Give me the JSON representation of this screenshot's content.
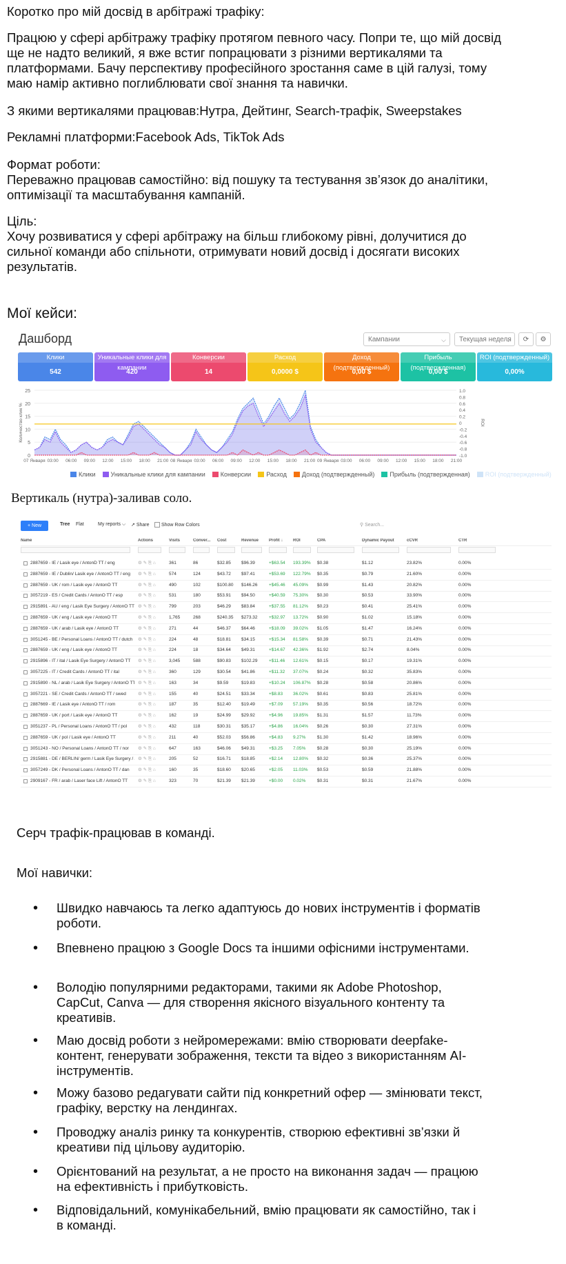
{
  "intro": {
    "heading": "Коротко про мій досвід в арбітражі трафіку:",
    "para": "Працюю у сфері арбітражу трафіку протягом певного часу. Попри те, що мій досвід ще не надто великий, я вже встиг попрацювати з різними вертикалями та платформами. Бачу перспективу професійного зростання саме в цій галузі, тому маю намір активно поглиблювати свої знання та навички.",
    "verticals": "З якими вертикалями працював:Нутра, Дейтинг, Search-трафік, Sweepstakes",
    "platforms": "Рекламні платформи:Facebook Ads, TikTok Ads",
    "format_label": "Формат роботи:",
    "format_text": "Переважно працював самостійно: від пошуку та тестування зв’язок до аналітики, оптимізації та масштабування кампаній.",
    "goal_label": "Ціль:",
    "goal_text": "Хочу розвиватися у сфері арбітражу на більш глибокому рівні, долучитися до сильної команди або спільноти, отримувати новий досвід і досягати високих результатів."
  },
  "cases_heading": "Мої кейси:",
  "dashboard": {
    "title": "Дашборд",
    "campaign_select": "Кампании",
    "period_select": "Текущая неделя",
    "cards": [
      {
        "label": "Клики",
        "value": "542",
        "color": "#4a86e8"
      },
      {
        "label": "Уникальные клики для кампании",
        "value": "420",
        "color": "#8e5cf0"
      },
      {
        "label": "Конверсии",
        "value": "14",
        "color": "#ec4a6e"
      },
      {
        "label": "Расход",
        "value": "0,0000 $",
        "color": "#f5c518"
      },
      {
        "label": "Доход (подтвержденный)",
        "value": "0,00 $",
        "color": "#f5730f"
      },
      {
        "label": "Прибыль (подтвержденная)",
        "value": "0,00 $",
        "color": "#1dc2a4"
      },
      {
        "label": "ROI (подтвержденный)",
        "value": "0,00%",
        "color": "#28b9dc"
      }
    ],
    "legend": [
      {
        "label": "Клики",
        "color": "#4a86e8"
      },
      {
        "label": "Уникальные клики для кампании",
        "color": "#8e5cf0"
      },
      {
        "label": "Конверсии",
        "color": "#ec4a6e"
      },
      {
        "label": "Расход",
        "color": "#f5c518"
      },
      {
        "label": "Доход (подтвержденный)",
        "color": "#f5730f"
      },
      {
        "label": "Прибыль (подтвержденная)",
        "color": "#1dc2a4"
      },
      {
        "label": "ROI (подтвержденный)",
        "color": "#cfe3f7"
      }
    ]
  },
  "chart_data": {
    "type": "area",
    "ylabel": "Количество клик %",
    "y2label": "ROI",
    "ylim": [
      0,
      25
    ],
    "y2lim": [
      -1.0,
      1.0
    ],
    "y_ticks": [
      "0",
      "5",
      "10",
      "15",
      "20",
      "25"
    ],
    "y2_ticks": [
      "-1.0",
      "-0.8",
      "-0.6",
      "-0.4",
      "-0.2",
      "0",
      "0.2",
      "0.4",
      "0.6",
      "0.8",
      "1.0"
    ],
    "x_ticks": [
      "07 Января",
      "03:00",
      "06:00",
      "09:00",
      "12:00",
      "15:00",
      "18:00",
      "21:00",
      "08 Января",
      "03:00",
      "06:00",
      "09:00",
      "12:00",
      "15:00",
      "18:00",
      "21:00",
      "09 Января",
      "03:00",
      "06:00",
      "09:00",
      "12:00",
      "15:00",
      "18:00",
      "21:00"
    ],
    "series": [
      {
        "name": "Клики",
        "color": "#4a86e8",
        "values": [
          2,
          3,
          7,
          6,
          10,
          6,
          4,
          1,
          2,
          4,
          5,
          3,
          2,
          3,
          6,
          7,
          5,
          4,
          8,
          12,
          13,
          11,
          9,
          7,
          5,
          3,
          1,
          0,
          0,
          2,
          5,
          10,
          7,
          4,
          2,
          1,
          3,
          6,
          9,
          14,
          18,
          20,
          22,
          17,
          12,
          15,
          19,
          22,
          18,
          14,
          16,
          20,
          25,
          11,
          6,
          3,
          1,
          0,
          0,
          0,
          0,
          0,
          0,
          0,
          0,
          0,
          0,
          0,
          0,
          0,
          0,
          0,
          0,
          0,
          0,
          0,
          0,
          0,
          0,
          0,
          0,
          0
        ]
      },
      {
        "name": "Уникальные клики для кампании",
        "color": "#8e5cf0",
        "values": [
          2,
          3,
          6,
          5,
          9,
          5,
          3,
          1,
          2,
          4,
          5,
          3,
          2,
          3,
          5,
          6,
          5,
          4,
          7,
          11,
          12,
          10,
          8,
          6,
          4,
          3,
          1,
          0,
          0,
          2,
          4,
          9,
          6,
          4,
          2,
          1,
          3,
          5,
          8,
          13,
          17,
          19,
          20,
          15,
          11,
          14,
          17,
          20,
          16,
          13,
          15,
          18,
          23,
          10,
          5,
          3,
          1,
          0,
          0,
          0,
          0,
          0,
          0,
          0,
          0,
          0,
          0,
          0,
          0,
          0,
          0,
          0,
          0,
          0,
          0,
          0,
          0,
          0,
          0,
          0,
          0,
          0
        ]
      },
      {
        "name": "Конверсии",
        "color": "#ec4a6e",
        "values": [
          0,
          0,
          0,
          0,
          0,
          0,
          0,
          0,
          0,
          1,
          0,
          0,
          0,
          0,
          0,
          0,
          0,
          0,
          0,
          1,
          0,
          0,
          0,
          1,
          0,
          0,
          0,
          0,
          0,
          0,
          0,
          0,
          0,
          0,
          0,
          0,
          0,
          0,
          1,
          0,
          2,
          1,
          0,
          1,
          0,
          0,
          1,
          2,
          1,
          0,
          0,
          1,
          2,
          0,
          1,
          0,
          0,
          0,
          0,
          0,
          0,
          0,
          0,
          0,
          0,
          0,
          0,
          0,
          0,
          0,
          0,
          0,
          0,
          0,
          0,
          0,
          0,
          0,
          0,
          0,
          0,
          0
        ]
      },
      {
        "name": "Расход",
        "color": "#f5c518",
        "values": [
          12,
          12,
          12,
          12,
          12,
          12,
          12,
          12,
          12,
          12,
          12,
          12,
          12,
          12,
          12,
          12,
          12,
          12,
          12,
          12,
          12,
          12,
          12,
          12,
          12,
          12,
          12,
          12,
          12,
          12,
          12,
          12,
          12,
          12,
          12,
          12,
          12,
          12,
          12,
          12,
          12,
          12,
          12,
          12,
          12,
          12,
          12,
          12,
          12,
          12,
          12,
          12,
          12,
          12,
          12,
          12,
          12,
          12,
          12,
          12,
          12,
          12,
          12,
          12,
          12,
          12,
          12,
          12,
          12,
          12,
          12,
          12,
          12,
          12,
          12,
          12,
          12,
          12,
          12,
          12,
          12,
          12
        ]
      }
    ]
  },
  "caption_nutra": "Вертикаль (нутра)-заливав соло.",
  "report_table": {
    "new_button": "New",
    "tabs": [
      "Tree",
      "Flat"
    ],
    "my_reports": "My reports",
    "share": "Share",
    "show_row_colors": "Show Row Colors",
    "search_placeholder": "Search...",
    "columns": [
      "Name",
      "Actions",
      "Visits",
      "Conver...",
      "Cost",
      "Revenue",
      "Profit ↓",
      "ROI",
      "CPA",
      "Dynamic Payout",
      "cCVR",
      "CTR"
    ],
    "rows": [
      [
        "2887659 - IE / Lasik eye / AntonD TT / eng",
        "361",
        "86",
        "$32.85",
        "$96.39",
        "+$63.54",
        "193.39%",
        "$0.38",
        "$1.12",
        "23.82%",
        "0.00%"
      ],
      [
        "2887659 - IE / Dublin/ Lasik eye / AntonO TT / eng",
        "574",
        "124",
        "$43.72",
        "$97.41",
        "+$53.69",
        "122.79%",
        "$0.35",
        "$0.79",
        "21.60%",
        "0.00%"
      ],
      [
        "2887659 - UK / rom / Lasik eye / AntonO TT",
        "490",
        "102",
        "$100.80",
        "$146.26",
        "+$45.46",
        "45.09%",
        "$0.99",
        "$1.43",
        "20.82%",
        "0.00%"
      ],
      [
        "3057219 - ES / Credit Cards / AntonO TT / esp",
        "531",
        "180",
        "$53.91",
        "$94.50",
        "+$40.59",
        "75.30%",
        "$0.30",
        "$0.53",
        "33.90%",
        "0.00%"
      ],
      [
        "2915891 - AU / eng / Lasik Eye Surgery / AntonO TT",
        "799",
        "203",
        "$46.29",
        "$83.84",
        "+$37.55",
        "81.12%",
        "$0.23",
        "$0.41",
        "25.41%",
        "0.00%"
      ],
      [
        "2887659 - UK / eng / Lasik eye / AntonO TT",
        "1,765",
        "268",
        "$240.35",
        "$273.32",
        "+$32.97",
        "13.72%",
        "$0.90",
        "$1.02",
        "15.18%",
        "0.00%"
      ],
      [
        "2887659 - UK / arab / Lasik eye / AntonO TT",
        "271",
        "44",
        "$46.37",
        "$64.46",
        "+$18.09",
        "39.02%",
        "$1.05",
        "$1.47",
        "16.24%",
        "0.00%"
      ],
      [
        "3051245 - BE / Personal Loans / AntonO TT / dutch",
        "224",
        "48",
        "$18.81",
        "$34.15",
        "+$15.34",
        "81.58%",
        "$0.39",
        "$0.71",
        "21.43%",
        "0.00%"
      ],
      [
        "2887659 - UK / eng / Lasik eye / AntonO TT",
        "224",
        "18",
        "$34.64",
        "$49.31",
        "+$14.67",
        "42.36%",
        "$1.92",
        "$2.74",
        "8.04%",
        "0.00%"
      ],
      [
        "2915896 - IT / ital / Lasik Eye Surgery / AntonO TT",
        "3,045",
        "588",
        "$90.83",
        "$102.29",
        "+$11.46",
        "12.61%",
        "$0.15",
        "$0.17",
        "19.31%",
        "0.00%"
      ],
      [
        "3057225 - IT / Credit Cards / AntonO TT / ital",
        "360",
        "129",
        "$30.54",
        "$41.86",
        "+$11.32",
        "37.07%",
        "$0.24",
        "$0.32",
        "35.83%",
        "0.00%"
      ],
      [
        "2915890 - NL / arab / Lasik Eye Surgery / AntonO TT",
        "163",
        "34",
        "$9.59",
        "$19.83",
        "+$10.24",
        "106.87%",
        "$0.28",
        "$0.58",
        "20.86%",
        "0.00%"
      ],
      [
        "3057221 - SE / Credit Cards / AntonO TT / swed",
        "155",
        "40",
        "$24.51",
        "$33.34",
        "+$8.83",
        "36.02%",
        "$0.61",
        "$0.83",
        "25.81%",
        "0.00%"
      ],
      [
        "2887669 - IE / Lasik eye / AntonO TT / rom",
        "187",
        "35",
        "$12.40",
        "$19.49",
        "+$7.09",
        "57.19%",
        "$0.35",
        "$0.56",
        "18.72%",
        "0.00%"
      ],
      [
        "2887659 - UK / port / Lasik eye / AntonO TT",
        "162",
        "19",
        "$24.99",
        "$29.92",
        "+$4.96",
        "19.85%",
        "$1.31",
        "$1.57",
        "11.73%",
        "0.00%"
      ],
      [
        "3051237 - PL / Personal Loans / AntonO TT / pol",
        "432",
        "118",
        "$30.31",
        "$35.17",
        "+$4.86",
        "16.04%",
        "$0.26",
        "$0.30",
        "27.31%",
        "0.00%"
      ],
      [
        "2887659 - UK / pol / Lasik eye / AntonO TT",
        "211",
        "40",
        "$52.03",
        "$56.86",
        "+$4.83",
        "9.27%",
        "$1.30",
        "$1.42",
        "18.96%",
        "0.00%"
      ],
      [
        "3051243 - NO / Personal Loans / AntonO TT / nor",
        "647",
        "163",
        "$46.06",
        "$49.31",
        "+$3.25",
        "7.05%",
        "$0.28",
        "$0.30",
        "25.19%",
        "0.00%"
      ],
      [
        "2915881 - DE / BERLIN/ germ / Lasik Eye Surgery / AntonO TT",
        "205",
        "52",
        "$16.71",
        "$18.85",
        "+$2.14",
        "12.80%",
        "$0.32",
        "$0.36",
        "25.37%",
        "0.00%"
      ],
      [
        "3057249 - DK / Personal Loans / AntonO TT / dan",
        "160",
        "35",
        "$18.60",
        "$20.65",
        "+$2.05",
        "11.03%",
        "$0.53",
        "$0.59",
        "21.88%",
        "0.00%"
      ],
      [
        "2909167 - FR / arab / Laser face Lift / AntonO TT",
        "323",
        "70",
        "$21.39",
        "$21.39",
        "+$0.00",
        "0.02%",
        "$0.31",
        "$0.31",
        "21.67%",
        "0.00%"
      ]
    ]
  },
  "caption_search": "Серч трафік-працював в команді.",
  "skills_heading": "Мої навички:",
  "skills": [
    "Швидко навчаюсь та легко адаптуюсь до нових інструментів і форматів роботи.",
    "Впевнено працюю з Google Docs та іншими офісними інструментами.",
    "Володію популярними редакторами, такими як Adobe Photoshop, CapCut, Canva — для створення якісного візуального контенту та креативів.",
    "Маю досвід роботи з нейромережами: вмію створювати deepfake-контент, генерувати зображення, тексти та відео з використанням AI-інструментів.",
    "Можу базово редагувати сайти під конкретний офер — змінювати текст, графіку, верстку на лендингах.",
    "Проводжу аналіз ринку та конкурентів, створюю ефективні зв’язки й креативи під цільову аудиторію.",
    "Орієнтований на результат, а не просто на виконання задач — працюю на ефективність і прибутковість.",
    "Відповідальний, комунікабельний, вмію працювати як самостійно, так і в команді."
  ]
}
